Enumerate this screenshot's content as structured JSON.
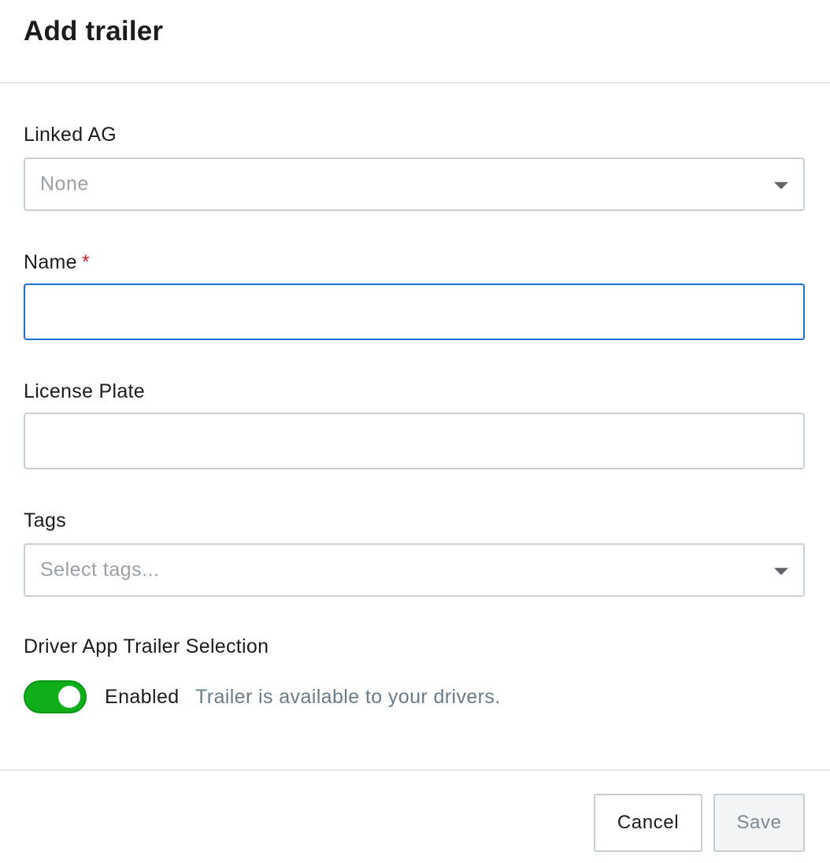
{
  "dialog": {
    "title": "Add trailer"
  },
  "fields": {
    "linked_ag": {
      "label": "Linked AG",
      "value": "None"
    },
    "name": {
      "label": "Name",
      "required_marker": "*",
      "value": ""
    },
    "license_plate": {
      "label": "License Plate",
      "value": ""
    },
    "tags": {
      "label": "Tags",
      "placeholder": "Select tags..."
    },
    "driver_app": {
      "label": "Driver App Trailer Selection",
      "toggle_on": true,
      "state_label": "Enabled",
      "description": "Trailer is available to your drivers."
    }
  },
  "footer": {
    "cancel_label": "Cancel",
    "save_label": "Save"
  },
  "colors": {
    "toggle_on": "#0fae1a",
    "focus_border": "#1f6ed4",
    "required": "#c6262e"
  }
}
